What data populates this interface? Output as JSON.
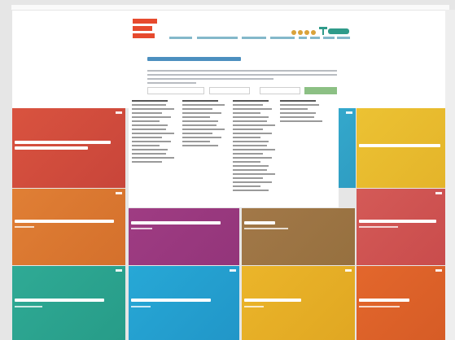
{
  "header": {
    "logo_text": "",
    "nav_items": [],
    "social_icons": [
      "social-icon-1",
      "social-icon-2",
      "social-icon-3",
      "social-icon-4"
    ],
    "account_button_label": ""
  },
  "intro": {
    "title": "",
    "search_placeholder": "",
    "filter_1_value": "",
    "filter_2_value": "",
    "search_button_label": ""
  },
  "dropdown": {
    "columns": [
      {
        "items": 15
      },
      {
        "items": 11
      },
      {
        "items": 22
      },
      {
        "items": 5
      }
    ]
  },
  "tiles": [
    {
      "title": "",
      "subtitle": "",
      "color": "#d9533f",
      "color2": "#c8453a"
    },
    {
      "title": "",
      "subtitle": "",
      "color": "#34a8cc",
      "color2": "#2f9dc2"
    },
    {
      "title": "",
      "subtitle": "",
      "color": "#ecc233",
      "color2": "#e4b42a"
    },
    {
      "title": "",
      "subtitle": "",
      "color": "#e07f35",
      "color2": "#d4702c"
    },
    {
      "title": "",
      "subtitle": "",
      "color": "#9f3c83",
      "color2": "#93357a"
    },
    {
      "title": "",
      "subtitle": "",
      "color": "#a27848",
      "color2": "#96703f"
    },
    {
      "title": "",
      "subtitle": "",
      "color": "#d45a57",
      "color2": "#c94c4c"
    },
    {
      "title": "",
      "subtitle": "",
      "color": "#2faa95",
      "color2": "#279c88"
    },
    {
      "title": "",
      "subtitle": "",
      "color": "#27a8d6",
      "color2": "#2196c8"
    },
    {
      "title": "",
      "subtitle": "",
      "color": "#ebb52a",
      "color2": "#e0a722"
    },
    {
      "title": "",
      "subtitle": "",
      "color": "#e3672c",
      "color2": "#d65c26"
    }
  ]
}
